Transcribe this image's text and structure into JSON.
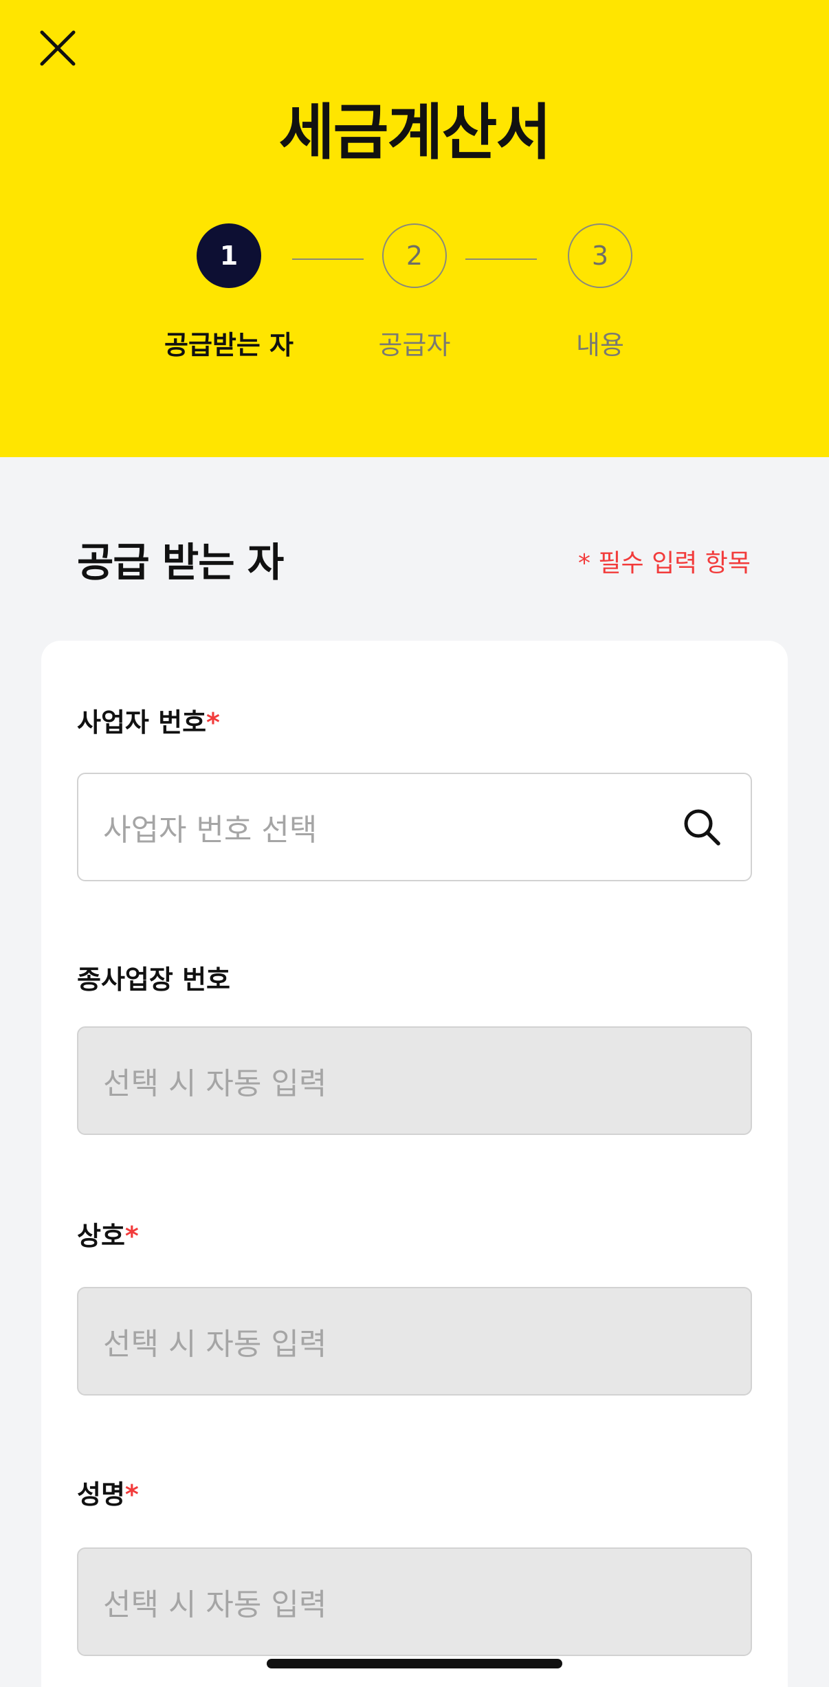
{
  "header": {
    "title": "세금계산서",
    "close_icon": "close-icon",
    "background_color": "#FFE500"
  },
  "stepper": {
    "steps": [
      {
        "number": "1",
        "label": "공급받는 자",
        "state": "active"
      },
      {
        "number": "2",
        "label": "공급자",
        "state": "inactive"
      },
      {
        "number": "3",
        "label": "내용",
        "state": "inactive"
      }
    ],
    "active_color": "#0D0F33"
  },
  "section": {
    "title": "공급 받는 자",
    "required_note": "* 필수 입력 항목",
    "required_color": "#F23B3B"
  },
  "form": {
    "fields": [
      {
        "label": "사업자 번호",
        "required": true,
        "placeholder": "사업자 번호 선택",
        "type": "search",
        "icon": "search-icon"
      },
      {
        "label": "종사업장 번호",
        "required": false,
        "placeholder": "선택 시 자동 입력",
        "type": "readonly"
      },
      {
        "label": "상호",
        "required": true,
        "placeholder": "선택 시 자동 입력",
        "type": "readonly"
      },
      {
        "label": "성명",
        "required": true,
        "placeholder": "선택 시 자동 입력",
        "type": "readonly"
      }
    ],
    "required_mark": "*"
  }
}
